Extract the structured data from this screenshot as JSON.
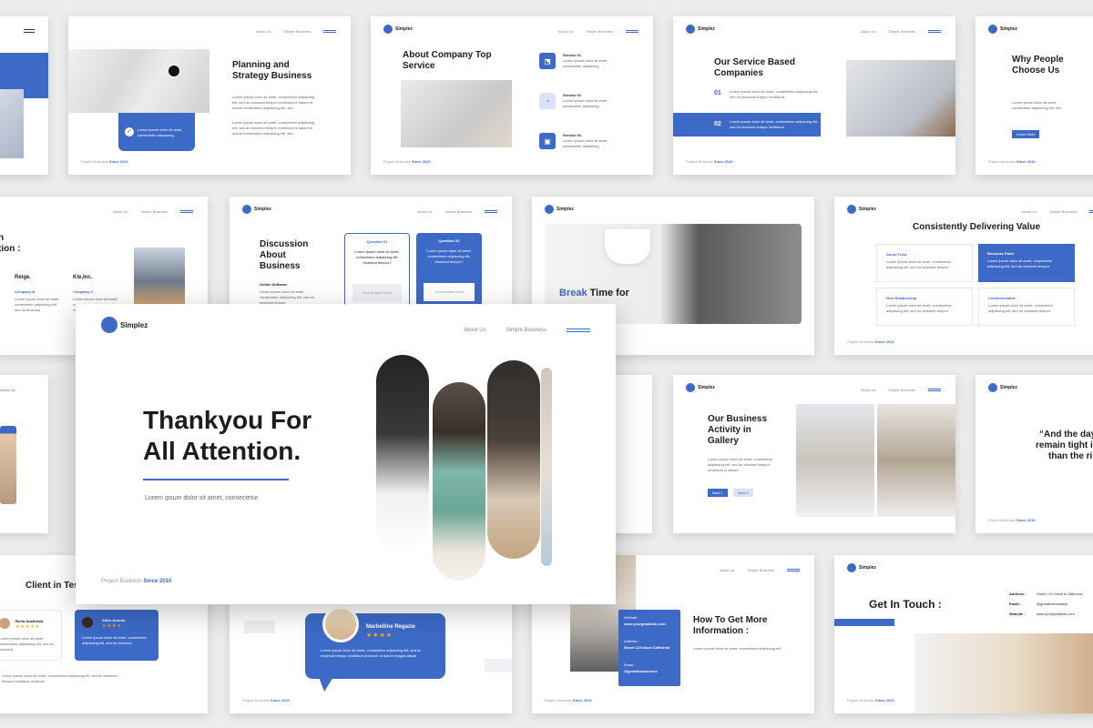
{
  "brand": {
    "name": "Simplez",
    "accent": "#3d6ac7"
  },
  "nav": {
    "about": "About Us",
    "simple": "Simple Business"
  },
  "footer": {
    "prefix": "Project Business",
    "since": "Since 2010"
  },
  "main_slide": {
    "title_line1": "Thankyou For",
    "title_line2": "All Attention.",
    "subtitle": "Lorem ipsum dolor sit amet, consectetur"
  },
  "slides": {
    "planning": {
      "title": "Planning and Strategy Business",
      "body": "Lorem ipsum dolor sit amet, consectetur adipiscing elit, sed do eiusmod tempor incididunt ut labore et dolore consectetur adipiscing elit, sed",
      "body2": "Lorem ipsum dolor sit amet, consectetur adipiscing elit, sed do eiusmod tempor incididunt ut labore et dolore consectetur adipiscing elit, sed",
      "card_text": "Lorem ipsum dolor sit amet, consectetur adipiscing"
    },
    "about_company": {
      "title": "About Company Top Service",
      "services": [
        {
          "name": "Service 01",
          "text": "Lorem ipsum dolor sit amet, consectetur adipiscing"
        },
        {
          "name": "Service 02",
          "text": "Lorem ipsum dolor sit amet, consectetur adipiscing"
        },
        {
          "name": "Service 03",
          "text": "Lorem ipsum dolor sit amet, consectetur adipiscing"
        }
      ]
    },
    "service_based": {
      "title": "Our Service Based Companies",
      "items": [
        {
          "num": "01",
          "text": "Lorem ipsum dolor sit amet, consectetur adipiscing elit, sed do eiusmod tempor incididunt"
        },
        {
          "num": "02",
          "text": "Lorem ipsum dolor sit amet, consectetur adipiscing elit, sed do eiusmod tempor incididunt"
        }
      ]
    },
    "why_people": {
      "title": "Why People Choose Us",
      "body": "Lorem ipsum dolor sit amet, consectetur adipiscing elit, sed",
      "button": "Learn More"
    },
    "team": {
      "title_fragment": "n",
      "title_fragment2": "tion :",
      "names": [
        "Reige.",
        "Kle,Inc."
      ],
      "companies": [
        "Company B",
        "Company C"
      ],
      "text": "Lorem ipsum dolor sit amet, consectetur adipiscing elit, sed do eiusmod"
    },
    "discussion": {
      "title": "Discussion About Business",
      "sub": "Online Software",
      "text": "Lorem ipsum dolor sit amet, consectetur adipiscing elit, sed do eiusmod tempor",
      "q1": "Question 01",
      "q2": "Question 02",
      "q_text": "Lorem ipsum dolor sit amet, consectetur adipiscing elit, eiusmod tempor?",
      "answer_placeholder": "Your Answer Here"
    },
    "break_time": {
      "highlight": "Break",
      "rest": "Time for"
    },
    "delivering": {
      "title": "Consistently Delivering Value",
      "cards": [
        {
          "name": "About Trust",
          "text": "Lorem ipsum dolor sit amet, consectetur adipiscing elit, sed do eiusmod tempor"
        },
        {
          "name": "Business Point",
          "text": "Lorem ipsum dolor sit amet, consectetur adipiscing elit, sed do eiusmod tempor"
        },
        {
          "name": "New Relationship",
          "text": "Lorem ipsum dolor sit amet, consectetur adipiscing elit, sed do eiusmod tempor"
        },
        {
          "name": "Communicative",
          "text": "Lorem ipsum dolor sit amet, consectetur adipiscing elit, sed do eiusmod tempor"
        }
      ]
    },
    "gallery": {
      "title": "Our Business Activity in Gallery",
      "text": "Lorem ipsum dolor sit amet, consectetur adipiscing elit, sed do eiusmod tempor incididunt ut labore",
      "btn1": "Next 1",
      "btn2": "Next 2"
    },
    "quote": {
      "line1": "“And the day",
      "line2": "remain tight i",
      "line3": "than the ri"
    },
    "client": {
      "title": "Client in Tes",
      "people": [
        {
          "name": "Berta Anathasia",
          "stars": "★★★★★",
          "text": "Lorem ipsum dolor sit amet, consectetur adipiscing elit, sed do eiusmod"
        },
        {
          "name": "Alina Joranta",
          "stars": "★★★★",
          "text": "Lorem ipsum dolor sit amet, consectetur adipiscing elit, sed do eiusmod"
        }
      ],
      "footer_text": "Lorem ipsum dolor sit amet, consectetur adipiscing elit, sed do eiusmod tempor incididunt ut labore"
    },
    "testimonial": {
      "name": "Marbelline Regazie",
      "stars": "★★★★",
      "text": "Lorem ipsum dolor sit amet, consectetur adipiscing elit, sed do eiusmod tempor incididunt ut labore et dolore magna aliqua"
    },
    "more_info": {
      "title": "How To Get More Information :",
      "text": "Lorem ipsum dolor sit amet, consectetur adipiscing elit",
      "website_label": "Website :",
      "website": "www.yourgmailsite.com",
      "address_label": "Address :",
      "address": "Street 123 block California",
      "email_label": "Email :",
      "email": "@greatbizbusiness"
    },
    "get_in_touch": {
      "title": "Get In Touch :",
      "address_label": "Address :",
      "address": "Street 123 block A California",
      "email_label": "Email :",
      "email": "@greatbizbusiness",
      "website_label": "Website :",
      "website": "www.yourgmailsite.com"
    }
  }
}
